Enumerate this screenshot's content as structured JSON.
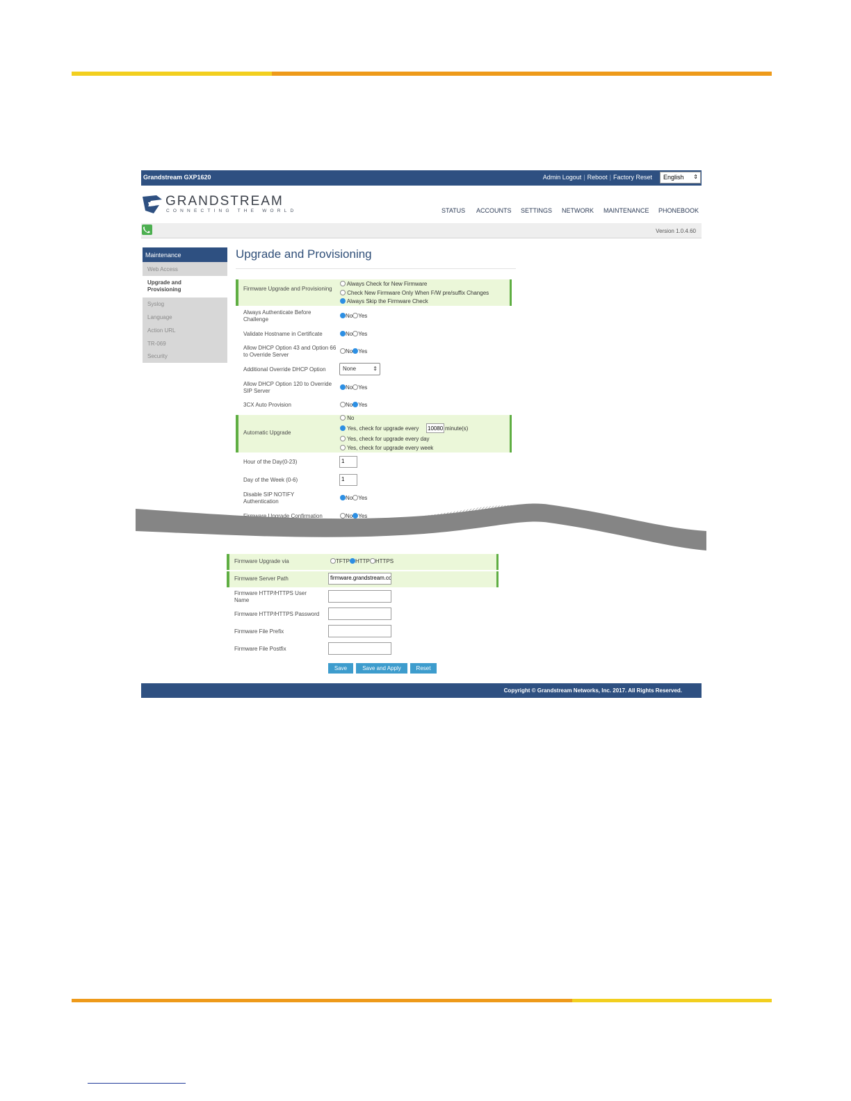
{
  "header": {
    "brand": "Grandstream GXP1620",
    "links": [
      "Admin Logout",
      "Reboot",
      "Factory Reset"
    ],
    "language": "English",
    "logo_text": "GRANDSTREAM",
    "logo_sub": "CONNECTING THE WORLD",
    "nav": [
      "STATUS",
      "ACCOUNTS",
      "SETTINGS",
      "NETWORK",
      "MAINTENANCE",
      "PHONEBOOK"
    ],
    "version": "Version 1.0.4.60"
  },
  "sidebar": {
    "section": "Maintenance",
    "items": [
      "Web Access",
      "Upgrade and Provisioning",
      "Syslog",
      "Language",
      "Action URL",
      "TR-069",
      "Security"
    ]
  },
  "page_title": "Upgrade and Provisioning",
  "form": {
    "fw_upgrade_label": "Firmware Upgrade and Provisioning",
    "fw_opts": [
      "Always Check for New Firmware",
      "Check New Firmware Only When F/W pre/suffix Changes",
      "Always Skip the Firmware Check"
    ],
    "auth_label": "Always Authenticate Before Challenge",
    "hostname_label": "Validate Hostname in Certificate",
    "dhcp43_label": "Allow DHCP Option 43 and Option 66 to Override Server",
    "override_label": "Additional Override DHCP Option",
    "override_value": "None",
    "dhcp120_label": "Allow DHCP Option 120 to Override SIP Server",
    "threecx_label": "3CX Auto Provision",
    "auto_upgrade_label": "Automatic Upgrade",
    "auto_opts": [
      "No",
      "Yes, check for upgrade every",
      "minute(s)",
      "Yes, check for upgrade every day",
      "Yes, check for upgrade every week"
    ],
    "minutes_value": "10080",
    "hour_label": "Hour of the Day(0-23)",
    "hour_value": "1",
    "dow_label": "Day of the Week (0-6)",
    "dow_value": "1",
    "sip_notify_label": "Disable SIP NOTIFY Authentication",
    "confirm_label": "Firmware Upgrade Confirmation",
    "no": "No",
    "yes": "Yes",
    "via_label": "Firmware Upgrade via",
    "via_opts": [
      "TFTP",
      "HTTP",
      "HTTPS"
    ],
    "server_label": "Firmware Server Path",
    "server_value": "firmware.grandstream.com",
    "user_label": "Firmware HTTP/HTTPS User Name",
    "pass_label": "Firmware HTTP/HTTPS Password",
    "prefix_label": "Firmware File Prefix",
    "postfix_label": "Firmware File Postfix"
  },
  "buttons": {
    "save": "Save",
    "save_apply": "Save and Apply",
    "reset": "Reset"
  },
  "footer": "Copyright © Grandstream Networks, Inc. 2017. All Rights Reserved."
}
